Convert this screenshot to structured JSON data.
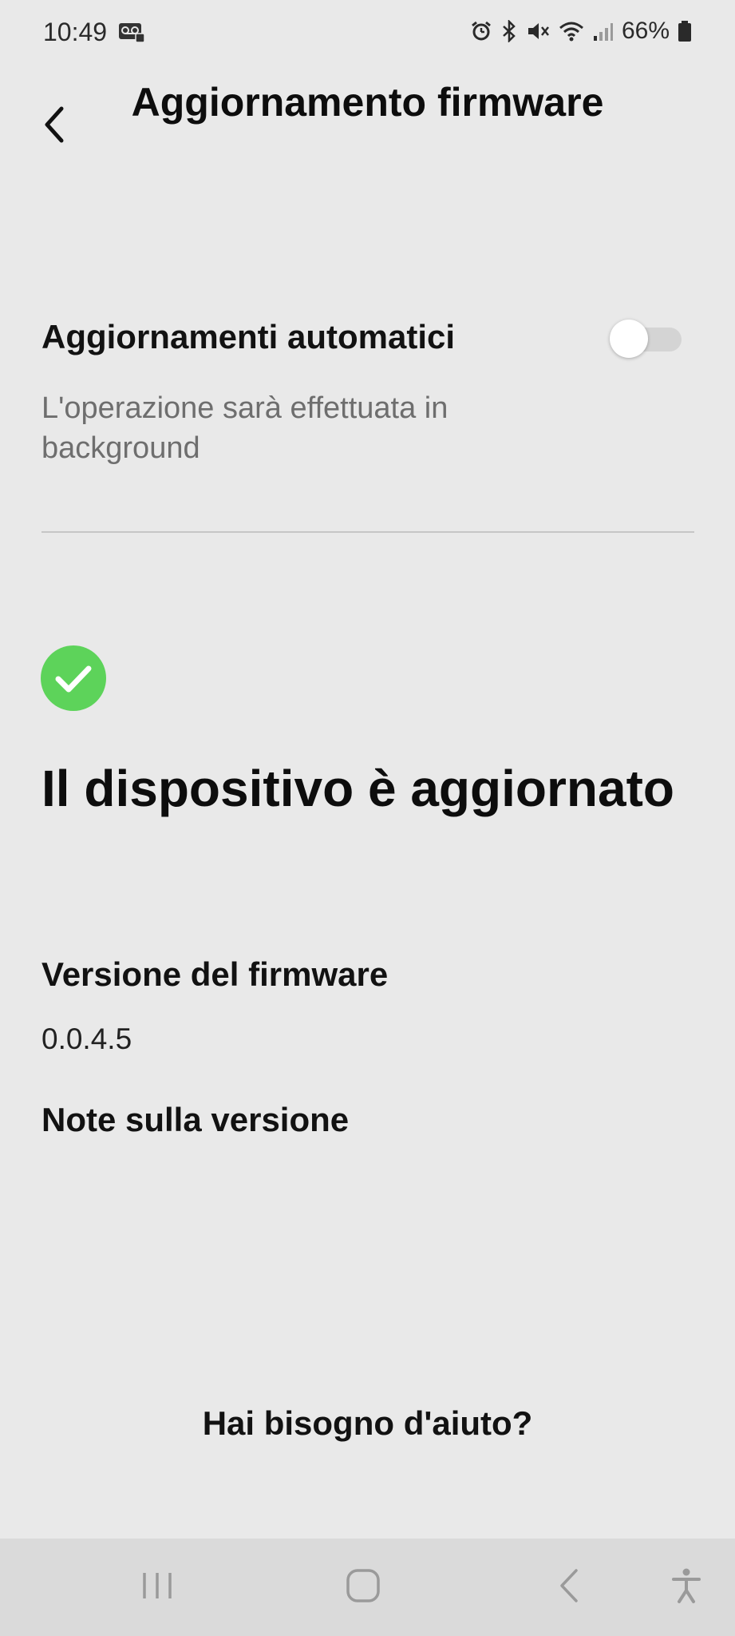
{
  "status_bar": {
    "time": "10:49",
    "battery": "66%",
    "icons": [
      "voicemail-icon",
      "alarm-icon",
      "bluetooth-icon",
      "mute-icon",
      "wifi-icon",
      "signal-icon",
      "battery-icon"
    ]
  },
  "header": {
    "title": "Aggiornamento firmware",
    "back_icon": "chevron-left-icon"
  },
  "auto_updates": {
    "label": "Aggiornamenti automatici",
    "description": "L'operazione sarà effettuata in background",
    "enabled": false
  },
  "status": {
    "icon": "check-circle-icon",
    "title": "Il dispositivo è aggiornato",
    "firmware_label": "Versione del firmware",
    "firmware_version": "0.0.4.5",
    "notes_label": "Note sulla versione"
  },
  "help": {
    "label": "Hai bisogno d'aiuto?"
  },
  "colors": {
    "background": "#e9e9e9",
    "success": "#5dd35a",
    "navbar": "#dadada",
    "divider": "#c6c6c6"
  }
}
